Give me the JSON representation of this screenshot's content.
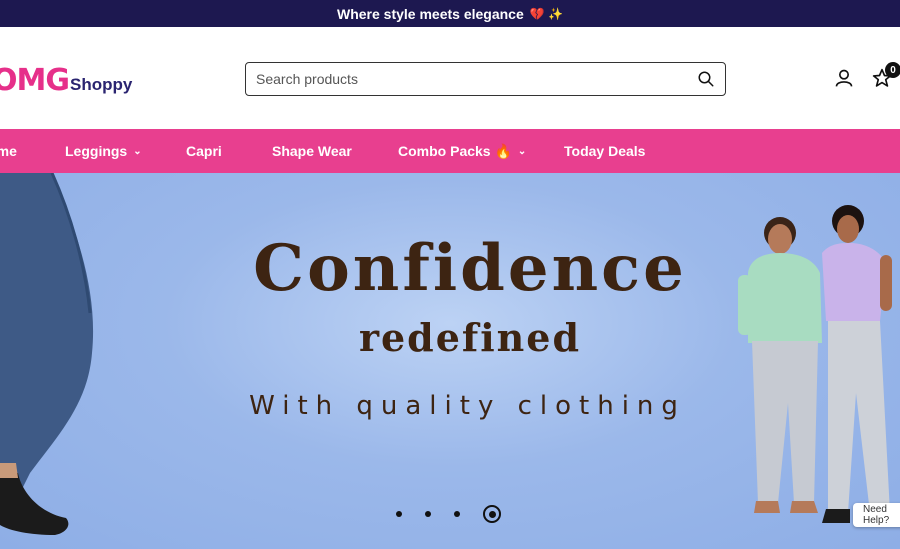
{
  "announcement": {
    "text": "Where style meets elegance",
    "emoji": "💔 ✨"
  },
  "logo": {
    "mark": "OMG",
    "word": "Shoppy"
  },
  "search": {
    "placeholder": "Search products"
  },
  "cart": {
    "count": "0"
  },
  "nav": {
    "items": [
      {
        "label": "Home"
      },
      {
        "label": "Leggings",
        "chevron": "⌄"
      },
      {
        "label": "Capri"
      },
      {
        "label": "Shape Wear"
      },
      {
        "label": "Combo Packs 🔥",
        "chevron": "⌄"
      },
      {
        "label": "Today Deals"
      }
    ]
  },
  "hero": {
    "headline": "Confidence",
    "subheadline": "redefined",
    "tagline": "With quality clothing",
    "slides": 4,
    "active_slide": 4
  },
  "help": {
    "label": "Need Help?"
  },
  "colors": {
    "announce_bg": "#1d1850",
    "nav_bg": "#e83f8f",
    "brand_pink": "#e6308a",
    "brand_navy": "#2a2470",
    "hero_text": "#3d2412"
  }
}
